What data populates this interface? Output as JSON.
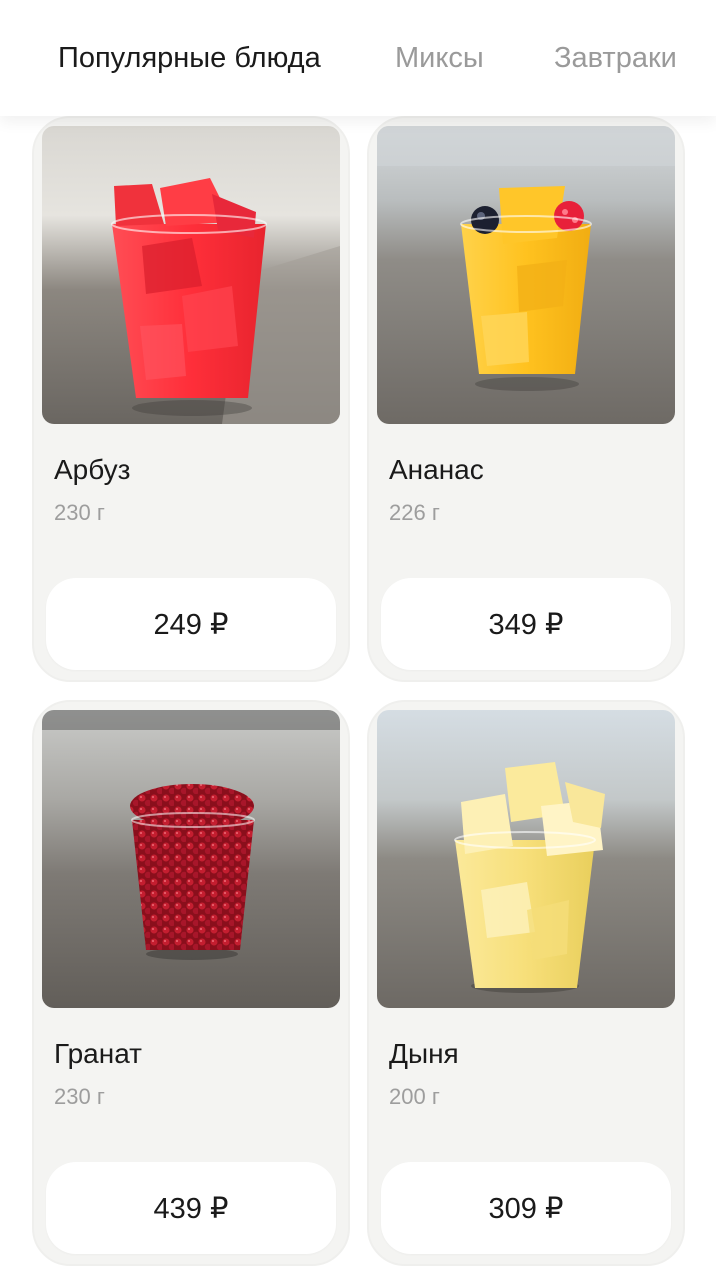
{
  "tabs": [
    {
      "label": "Популярные блюда",
      "active": true
    },
    {
      "label": "Миксы",
      "active": false
    },
    {
      "label": "Завтраки",
      "active": false
    }
  ],
  "products": [
    {
      "name": "Арбуз",
      "weight": "230 г",
      "price": "249 ₽",
      "photo_icon": "watermelon-cup-photo"
    },
    {
      "name": "Ананас",
      "weight": "226 г",
      "price": "349 ₽",
      "photo_icon": "pineapple-cup-photo"
    },
    {
      "name": "Гранат",
      "weight": "230 г",
      "price": "439 ₽",
      "photo_icon": "pomegranate-cup-photo"
    },
    {
      "name": "Дыня",
      "weight": "200 г",
      "price": "309 ₽",
      "photo_icon": "melon-cup-photo"
    }
  ],
  "colors": {
    "card_bg": "#f4f4f2",
    "text_primary": "#1a1a1a",
    "text_secondary": "#9d9d9d",
    "tab_inactive": "#9a9a9a"
  }
}
